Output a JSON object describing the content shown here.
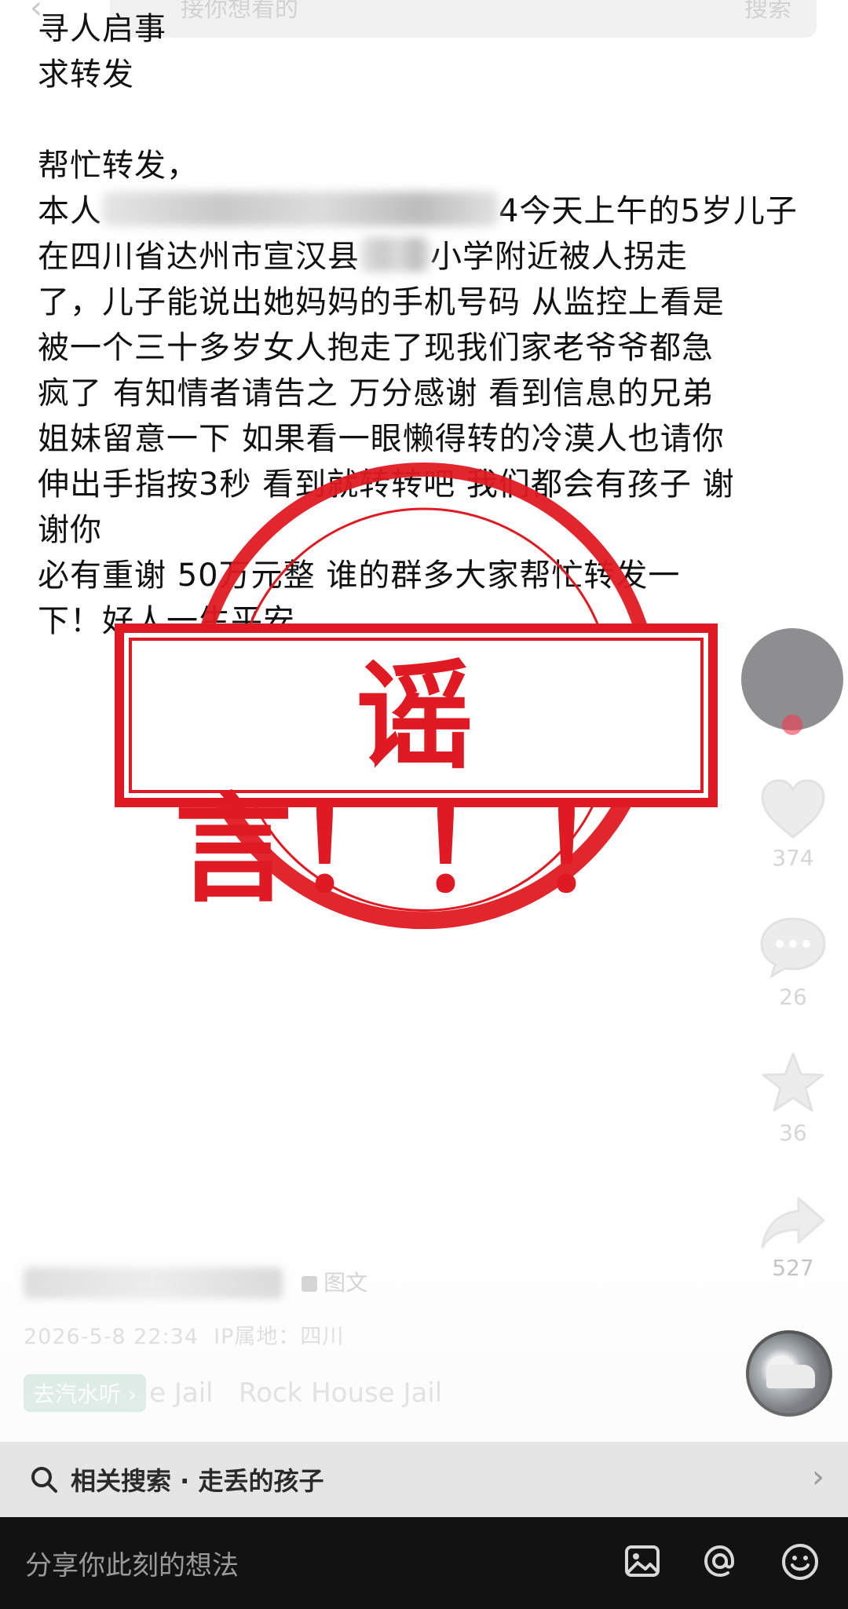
{
  "top_bar": {
    "back_icon": "chevron-left-icon",
    "search_placeholder": "接你想看的",
    "search_button": "搜索"
  },
  "post": {
    "lines": [
      "寻人启事",
      "求转发",
      "",
      "帮忙转发，",
      "在四川省达州市宣汉县",
      "了，儿子能说出她妈妈的手机号码 从监控上看是",
      "被一个三十多岁女人抱走了现我们家老爷爷都急",
      "疯了 有知情者请告之 万分感谢 看到信息的兄弟",
      "姐妹留意一下 如果看一眼懒得转的冷漠人也请你",
      "伸出手指按3秒 看到就转转吧 我们都会有孩子 谢",
      "谢你",
      "必有重谢 50万元整 谁的群多大家帮忙转发一",
      "下！好人一生平安"
    ],
    "line5_prefix": "本人",
    "line5_suffix": "4今天上午的5岁儿子",
    "line6_suffix": "小学附近被人拐走"
  },
  "stamp": {
    "text": "谣言！！！",
    "color": "#e01a22"
  },
  "actions": {
    "like_count": "374",
    "comment_count": "26",
    "favorite_count": "36",
    "share_count": "527"
  },
  "author": {
    "type_tag": "图文",
    "date": "2026-5-8 22:34",
    "ip_location": "IP属地：四川"
  },
  "music": {
    "chip_label": "去汽水听",
    "track": "e Jail   Rock House Jail"
  },
  "related": {
    "label": "相关搜索 · 走丢的孩子"
  },
  "comment_bar": {
    "placeholder": "分享你此刻的想法"
  },
  "colors": {
    "accent_red": "#e01a22",
    "bottom_bar": "#121212",
    "related_bg": "#e5e5e5"
  }
}
